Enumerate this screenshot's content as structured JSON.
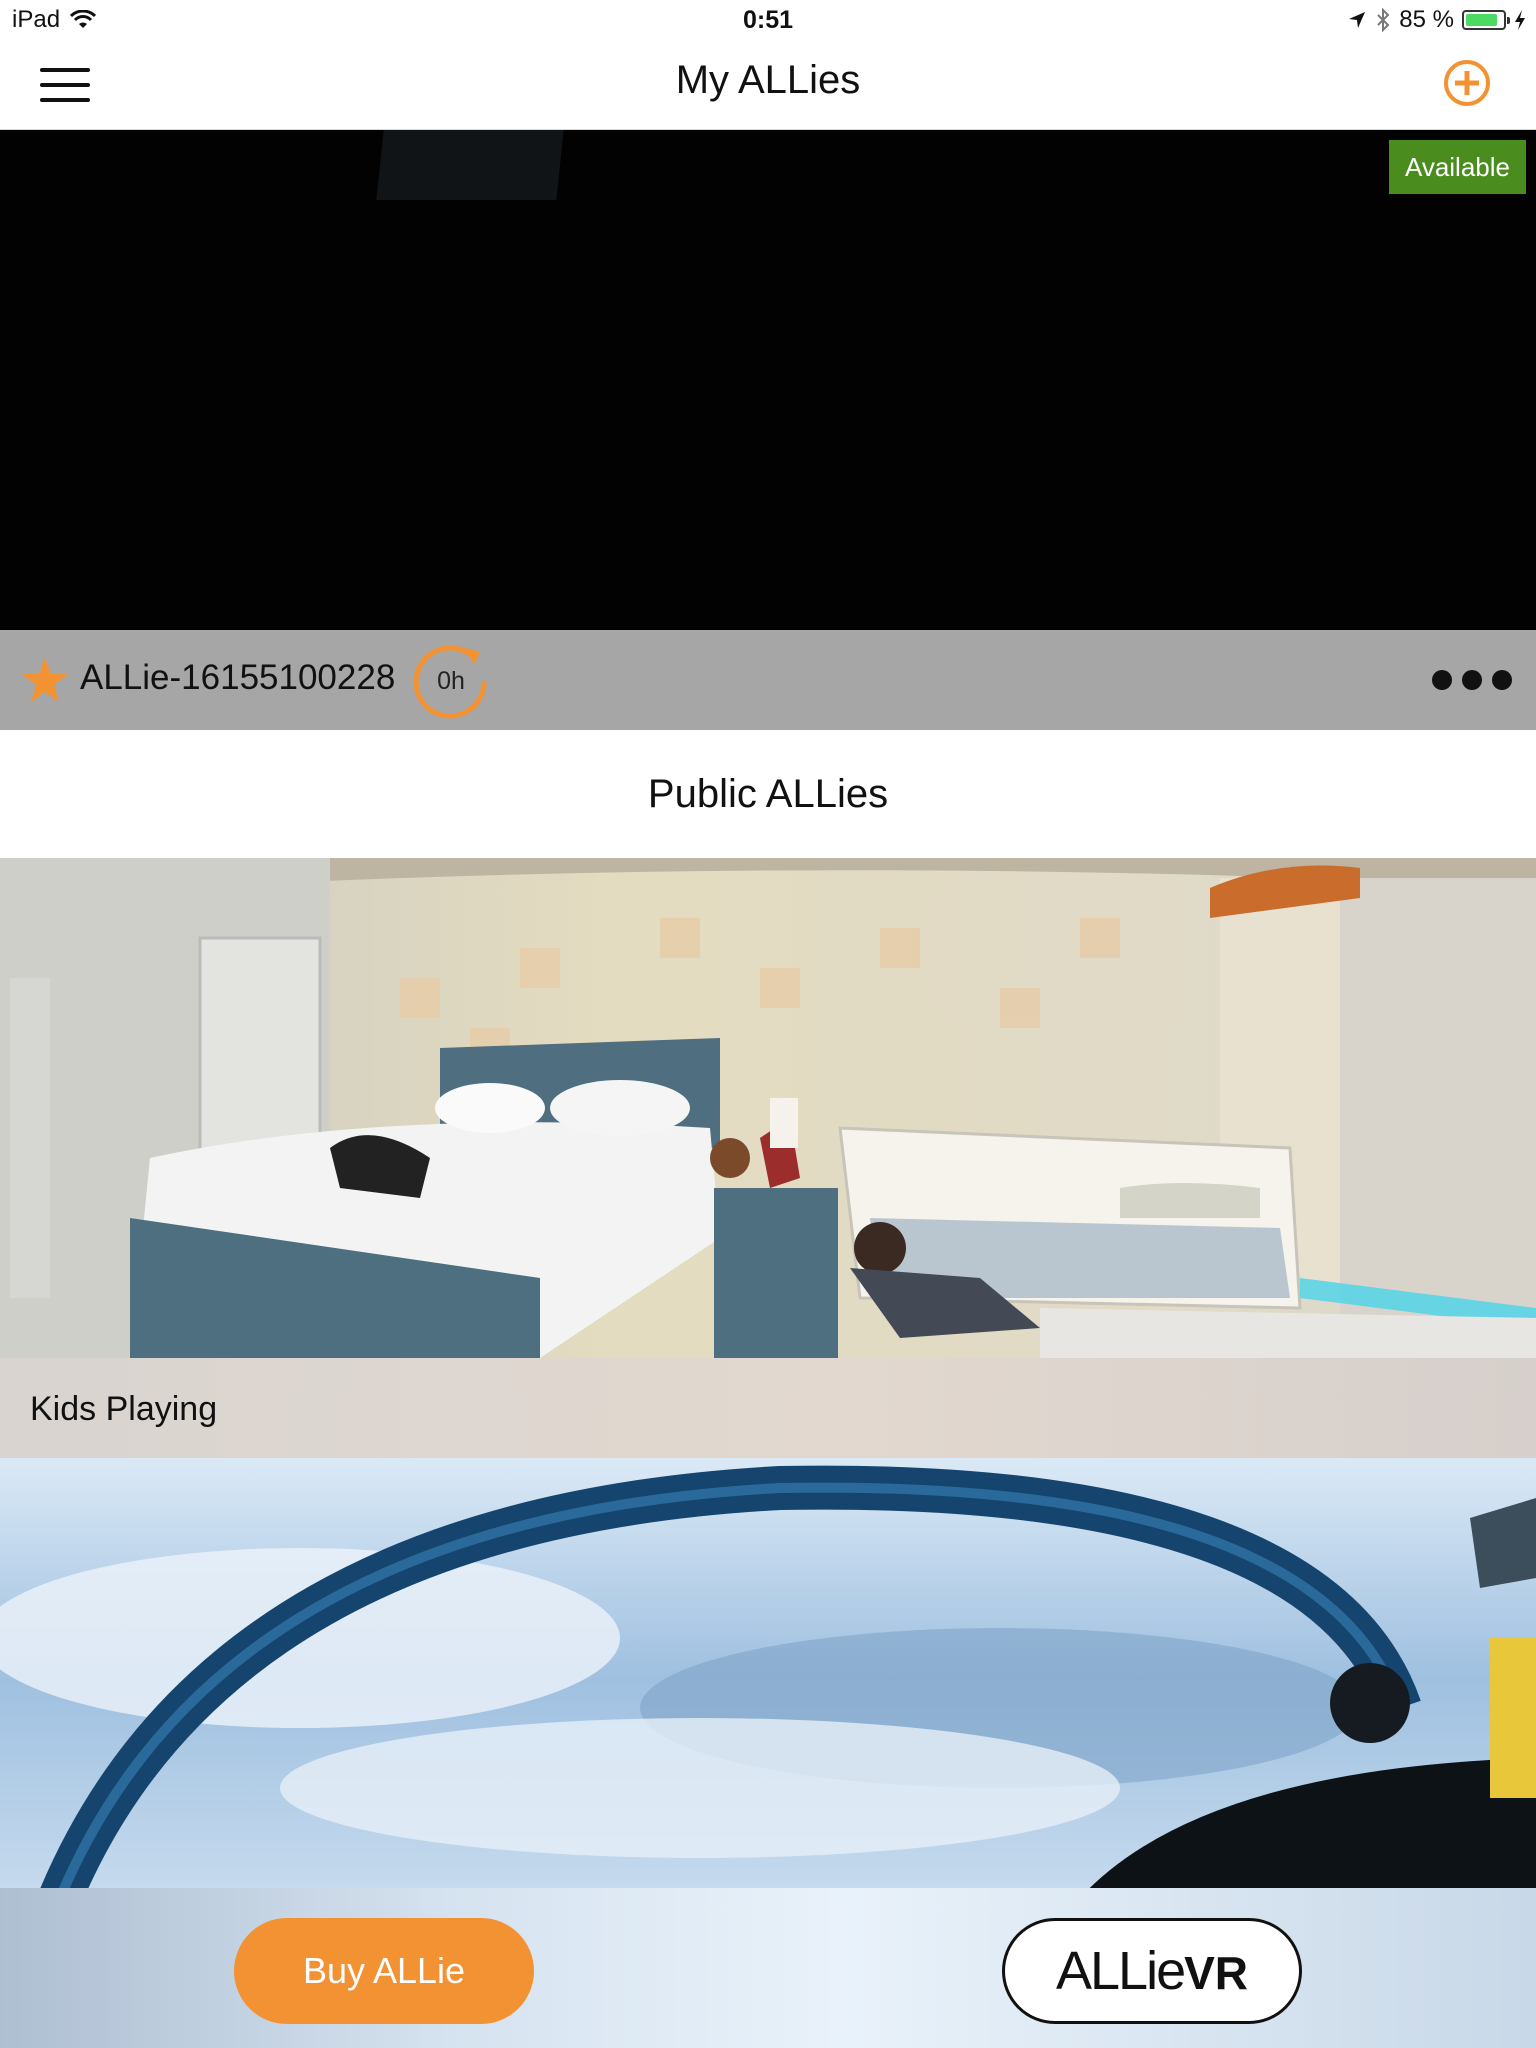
{
  "status_bar": {
    "device": "iPad",
    "time": "0:51",
    "battery_text": "85 %",
    "battery_level": 0.85
  },
  "nav": {
    "title": "My ALLies"
  },
  "my_camera": {
    "status_badge": "Available",
    "name": "ALLie-16155100228",
    "timer": "0h"
  },
  "public_section": {
    "title": "Public ALLies",
    "feeds": [
      {
        "label": "Kids Playing"
      }
    ]
  },
  "bottom": {
    "buy_label": "Buy  ALLie",
    "vr_label_allie": "ALLie",
    "vr_label_vr": "VR"
  },
  "colors": {
    "accent_orange": "#f39232",
    "badge_green": "#4a8c1d",
    "card_bar_gray": "#a6a6a6"
  },
  "icons": [
    "wifi-icon",
    "location-arrow-icon",
    "bluetooth-icon",
    "battery-icon",
    "charging-bolt-icon",
    "hamburger-menu-icon",
    "add-circle-icon",
    "star-icon",
    "timer-refresh-icon",
    "more-options-icon"
  ]
}
